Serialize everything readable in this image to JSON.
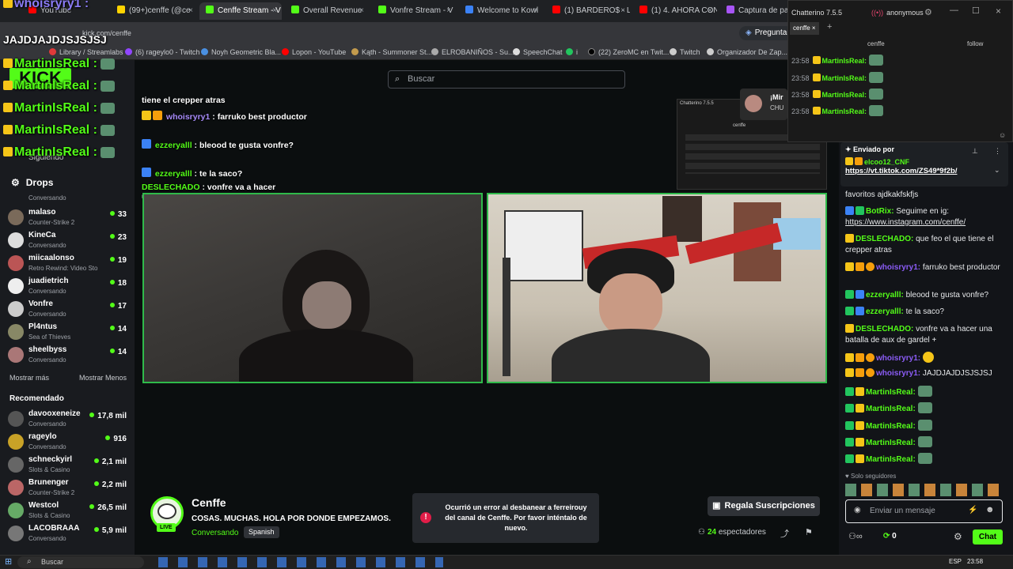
{
  "browser": {
    "tabs": [
      {
        "label": "YouTube",
        "color": "#ff0000"
      },
      {
        "label": "(99+)cenffe (@ce",
        "color": "#ffd400"
      },
      {
        "label": "Cenffe Stream - V",
        "color": "#53fc18",
        "active": true
      },
      {
        "label": "Overall Revenue",
        "color": "#53fc18"
      },
      {
        "label": "Vonfre Stream - V",
        "color": "#53fc18"
      },
      {
        "label": "Welcome to Kowl",
        "color": "#3b82f6"
      },
      {
        "label": "(1) BARDERO$ - L",
        "color": "#ff0000"
      },
      {
        "label": "(1) 4. AHORA CON",
        "color": "#ff0000"
      },
      {
        "label": "Captura de panta",
        "color": "#a855f7"
      }
    ],
    "address": "kick.com/cenffe",
    "ask_button": "Preguntar",
    "bookmarks": [
      "Library / Streamlabs",
      "(6) rageylo0 - Twitch",
      "Noyh Geometric Bla...",
      "Lopon - YouTube",
      "Kąth - Summoner St...",
      "ELROBANIÑOS - Su...",
      "SpeechChat",
      "i",
      "(22) ZeroMC en Twit...",
      "Twitch",
      "Organizador De Zap..."
    ]
  },
  "overlay": {
    "lines": [
      {
        "user": "whoisryry1 :",
        "msg": "JAJDJAJDJSJSJSJ"
      },
      {
        "user": "MartinIsReal :"
      },
      {
        "user": "MartinIsReal :"
      },
      {
        "user": "MartinIsReal :"
      },
      {
        "user": "MartinIsReal :"
      },
      {
        "user": "MartinIsReal :"
      }
    ]
  },
  "sidebar": {
    "following_label": "Siguiendo",
    "drops_label": "Drops",
    "following": [
      {
        "name": "",
        "game": "Conversando",
        "viewers": ""
      },
      {
        "name": "malaso",
        "game": "Counter-Strike 2",
        "viewers": "33"
      },
      {
        "name": "KineCa",
        "game": "Conversando",
        "viewers": "23"
      },
      {
        "name": "miicaalonso",
        "game": "Retro Rewind: Video Sto...",
        "viewers": "19"
      },
      {
        "name": "juadietrich",
        "game": "Conversando",
        "viewers": "18"
      },
      {
        "name": "Vonfre",
        "game": "Conversando",
        "viewers": "17"
      },
      {
        "name": "Pl4ntus",
        "game": "Sea of Thieves",
        "viewers": "14"
      },
      {
        "name": "sheelbyss",
        "game": "Conversando",
        "viewers": "14"
      }
    ],
    "show_more": "Mostrar más",
    "show_less": "Mostrar Menos",
    "recommended_label": "Recomendado",
    "recommended": [
      {
        "name": "davooxeneize",
        "game": "Conversando",
        "viewers": "17,8 mil"
      },
      {
        "name": "rageylo",
        "game": "Conversando",
        "viewers": "916"
      },
      {
        "name": "schneckyirl",
        "game": "Slots & Casino",
        "viewers": "2,1 mil"
      },
      {
        "name": "Brunenger",
        "game": "Counter-Strike 2",
        "viewers": "2,2 mil"
      },
      {
        "name": "Westcol",
        "game": "Slots & Casino",
        "viewers": "26,5 mil"
      },
      {
        "name": "LACOBRAAA",
        "game": "Conversando",
        "viewers": "5,9 mil"
      }
    ]
  },
  "main": {
    "search_placeholder": "Buscar",
    "stream_chat": [
      {
        "user": "",
        "msg": "tiene el crepper atras"
      },
      {
        "user": "whoisryry1",
        "msg": ": farruko best productor"
      },
      {
        "user": "ezzeryalll",
        "msg": ": bleood te gusta vonfre?"
      },
      {
        "user": "ezzeryalll",
        "msg": ": te la saco?"
      },
      {
        "user": "DESLECHADO",
        "msg": ": vonfre va a hacer una batalla de aux de gardel +"
      }
    ],
    "streamer": "Cenffe",
    "live_badge": "LIVE",
    "stream_title": "COSAS. MUCHAS. HOLA POR DONDE EMPEZAMOS.",
    "category": "Conversando",
    "language": "Spanish",
    "error_text": "Ocurrió un error al desbanear a ferreirouy del canal de Cenffe. Por favor inténtalo de nuevo.",
    "gift_button": "Regala Suscripciones",
    "viewers": "24",
    "viewers_label": "espectadores"
  },
  "chatterino": {
    "title": "Chatterino 7.5.5",
    "account": "anonymous",
    "tab": "cenffe",
    "channel": "cenffe",
    "follow": "follow",
    "lines": [
      {
        "time": "23:58",
        "user": "MartinIsReal:"
      },
      {
        "time": "23:58",
        "user": "MartinIsReal:"
      },
      {
        "time": "23:58",
        "user": "MartinIsReal:"
      },
      {
        "time": "23:58",
        "user": "MartinIsReal:"
      }
    ],
    "preview_title": "Chatterino 7.5.5",
    "preview_user": "¡Mir",
    "preview_user2": "CHU"
  },
  "chat": {
    "pinned_label": "Enviado por",
    "pinned_user": "elcoo12_CNF",
    "pinned_link": "https://vt.tiktok.com/ZS49*9f2b/",
    "messages": [
      {
        "user": "",
        "text": "favoritos ajdkakfskfjs",
        "color": "#e6e8ea"
      },
      {
        "user": "BotRix:",
        "text": "Seguime en ig:",
        "link": "https://www.instagram.com/cenffe/",
        "color": "#53fc18"
      },
      {
        "user": "DESLECHADO:",
        "text": "que feo el que tiene el crepper atras",
        "color": "#53fc18"
      },
      {
        "user": "whoisryry1:",
        "text": "farruko best productor",
        "color": "#8b5cf6"
      },
      {
        "user": "ezzeryalll:",
        "text": "bleood te gusta vonfre?",
        "color": "#53fc18"
      },
      {
        "user": "ezzeryalll:",
        "text": "te la saco?",
        "color": "#53fc18"
      },
      {
        "user": "DESLECHADO:",
        "text": "vonfre va a hacer una batalla de aux de gardel +",
        "color": "#53fc18"
      },
      {
        "user": "whoisryry1:",
        "text": "",
        "color": "#8b5cf6"
      },
      {
        "user": "whoisryry1:",
        "text": "JAJDJAJDJSJSJSJ",
        "color": "#8b5cf6"
      },
      {
        "user": "MartinIsReal:",
        "text": "",
        "color": "#53fc18"
      },
      {
        "user": "MartinIsReal:",
        "text": "",
        "color": "#53fc18"
      },
      {
        "user": "MartinIsReal:",
        "text": "",
        "color": "#53fc18"
      },
      {
        "user": "MartinIsReal:",
        "text": "",
        "color": "#53fc18"
      },
      {
        "user": "MartinIsReal:",
        "text": "",
        "color": "#53fc18"
      }
    ],
    "followers_only": "Solo seguidores",
    "input_placeholder": "Enviar un mensaje",
    "points": "0",
    "send_button": "Chat"
  },
  "taskbar": {
    "search": "Buscar",
    "lang": "ESP",
    "time": "23:58"
  },
  "colors": {
    "kick_green": "#53fc18",
    "bg": "#0b0e0f",
    "panel": "#191b1f"
  }
}
